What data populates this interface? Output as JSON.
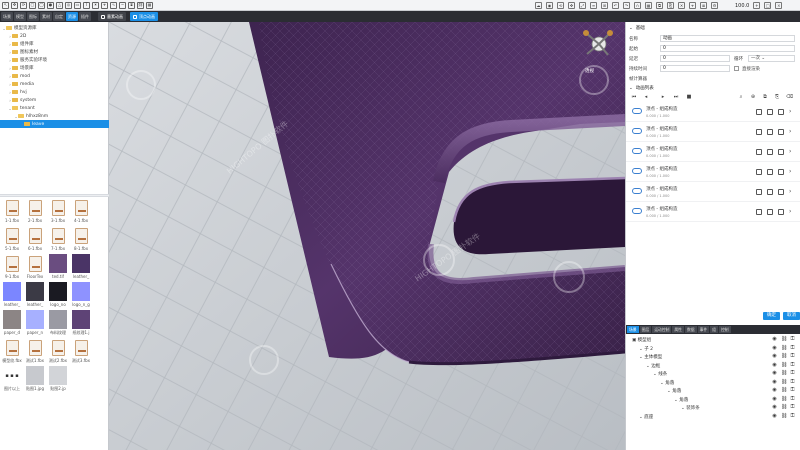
{
  "toolbar": {
    "zoom": "100.0",
    "left_icons": [
      "select-icon",
      "move-icon",
      "rotate-icon",
      "box-icon",
      "cylinder-icon",
      "sphere-icon",
      "cone-icon",
      "torus-icon",
      "plane-icon",
      "text-icon",
      "light-icon",
      "camera-icon",
      "path-icon",
      "curve-icon",
      "group-icon",
      "link-icon",
      "grid-icon"
    ],
    "right_icons": [
      "cloud-icon",
      "eye-icon",
      "rotate-view-icon",
      "move-view-icon",
      "scale-view-icon",
      "align-icon",
      "snap-icon",
      "undo-icon",
      "redo-icon",
      "magnet-icon",
      "grid-icon",
      "copy-icon",
      "paste-icon",
      "delete-icon",
      "camera-icon",
      "layer-icon",
      "settings-icon"
    ],
    "zoom_icons": [
      "zoom-in-icon",
      "fullscreen-icon",
      "close-icon"
    ]
  },
  "panel_tabs": [
    {
      "label": "场景",
      "active": false
    },
    {
      "label": "模型",
      "active": false
    },
    {
      "label": "图标",
      "active": false
    },
    {
      "label": "素材",
      "active": false
    },
    {
      "label": "自定",
      "active": false
    },
    {
      "label": "资源",
      "active": true
    },
    {
      "label": "插件",
      "active": false
    }
  ],
  "doc_tabs": [
    {
      "label": "墨素动画",
      "active": false
    },
    {
      "label": "顶点动画",
      "active": true
    }
  ],
  "left_tree": [
    {
      "label": "模型资源库",
      "indent": 0,
      "open": true
    },
    {
      "label": "2D",
      "indent": 1,
      "open": false
    },
    {
      "label": "组件库",
      "indent": 1,
      "open": false
    },
    {
      "label": "图标素材",
      "indent": 1,
      "open": false
    },
    {
      "label": "服务实验环境",
      "indent": 1,
      "open": false
    },
    {
      "label": "场景库",
      "indent": 1,
      "open": false
    },
    {
      "label": "mod",
      "indent": 1,
      "open": false
    },
    {
      "label": "media",
      "indent": 1,
      "open": false
    },
    {
      "label": "hvj",
      "indent": 1,
      "open": false
    },
    {
      "label": "system",
      "indent": 1,
      "open": false
    },
    {
      "label": "tenant",
      "indent": 1,
      "open": true
    },
    {
      "label": "hlhxz8nm",
      "indent": 2,
      "open": true
    },
    {
      "label": "leave",
      "indent": 3,
      "open": false,
      "selected": true
    }
  ],
  "assets": [
    {
      "label": "1-1.fbx",
      "kind": "file"
    },
    {
      "label": "2-1.fbx",
      "kind": "file"
    },
    {
      "label": "3-1.fbx",
      "kind": "file"
    },
    {
      "label": "4-1.fbx",
      "kind": "file"
    },
    {
      "label": "5-1.fbx",
      "kind": "file"
    },
    {
      "label": "6-1.fbx",
      "kind": "file"
    },
    {
      "label": "7-1.fbx",
      "kind": "file"
    },
    {
      "label": "8-1.fbx",
      "kind": "file"
    },
    {
      "label": "9-1.fbx",
      "kind": "file"
    },
    {
      "label": "FloorTex",
      "kind": "file"
    },
    {
      "label": "ted.tif",
      "kind": "swatch",
      "color": "#6a4d80"
    },
    {
      "label": "leather_",
      "kind": "swatch",
      "color": "#4a3466"
    },
    {
      "label": "leather_",
      "kind": "swatch",
      "color": "#7b86ff"
    },
    {
      "label": "leather_",
      "kind": "swatch",
      "color": "#3b3a45"
    },
    {
      "label": "logo_no",
      "kind": "swatch",
      "color": "#1a1a22"
    },
    {
      "label": "logo_n_g",
      "kind": "swatch",
      "color": "#8e92ff"
    },
    {
      "label": "paper_d",
      "kind": "swatch",
      "color": "#8c8585"
    },
    {
      "label": "paper_n",
      "kind": "swatch",
      "color": "#a7b0ff"
    },
    {
      "label": "布料纹理",
      "kind": "swatch",
      "color": "#9a9aa3"
    },
    {
      "label": "纸纹理1.j",
      "kind": "swatch",
      "color": "#5e4376"
    },
    {
      "label": "模型纹.fbx",
      "kind": "file"
    },
    {
      "label": "测试1.fbx",
      "kind": "file"
    },
    {
      "label": "测试2.fbx",
      "kind": "file"
    },
    {
      "label": "测试3.fbx",
      "kind": "file"
    },
    {
      "label": "图片以上",
      "kind": "text"
    },
    {
      "label": "贴图1.jpg",
      "kind": "swatch",
      "color": "#c7c9ce"
    },
    {
      "label": "贴图2.jp",
      "kind": "swatch",
      "color": "#d2d4d8"
    }
  ],
  "viewport": {
    "view_label": "透视",
    "watermark": "HIGHTOPO 图扑软件",
    "colors": {
      "leather": "#4e2f63",
      "leather_light": "#7d5a93",
      "floor": "#c9cdd2",
      "floor_dark": "#b7bcc2"
    }
  },
  "props": {
    "section_title": "基础",
    "rows": [
      {
        "label": "名称",
        "value": "动画"
      },
      {
        "label": "起始",
        "value": "0"
      },
      {
        "label": "延迟",
        "value": "0",
        "extra": "循环",
        "extra_value": "一次"
      },
      {
        "label": "持续时间",
        "value": "0",
        "check": "直接渲染"
      },
      {
        "label": "帧计算器",
        "value": ""
      }
    ],
    "anim_section": "动画列表",
    "anim_items": [
      {
        "name": "顶点 - 组成构造",
        "time": "0.000 / 1.000"
      },
      {
        "name": "顶点 - 组成构造",
        "time": "0.000 / 1.000"
      },
      {
        "name": "顶点 - 组成构造",
        "time": "0.000 / 1.000"
      },
      {
        "name": "顶点 - 组成构造",
        "time": "0.000 / 1.000"
      },
      {
        "name": "顶点 - 组成构造",
        "time": "0.000 / 1.000"
      },
      {
        "name": "顶点 - 组成构造",
        "time": "0.000 / 1.000"
      }
    ],
    "ok_label": "确定",
    "cancel_label": "取消"
  },
  "right_tabs": [
    {
      "label": "场景",
      "active": true
    },
    {
      "label": "图层",
      "active": false
    },
    {
      "label": "运动控制",
      "active": false
    },
    {
      "label": "属性",
      "active": false
    },
    {
      "label": "数据",
      "active": false
    },
    {
      "label": "事件",
      "active": false
    },
    {
      "label": "组",
      "active": false
    },
    {
      "label": "控制",
      "active": false
    }
  ],
  "scene_tree": [
    {
      "label": "模型组",
      "indent": 0
    },
    {
      "label": "子 2",
      "indent": 1
    },
    {
      "label": "主体模型",
      "indent": 1
    },
    {
      "label": "边框",
      "indent": 2
    },
    {
      "label": "线条",
      "indent": 3
    },
    {
      "label": "角落",
      "indent": 4
    },
    {
      "label": "角落",
      "indent": 5
    },
    {
      "label": "角落",
      "indent": 6
    },
    {
      "label": "装饰条",
      "indent": 7
    },
    {
      "label": "底座",
      "indent": 1
    }
  ]
}
